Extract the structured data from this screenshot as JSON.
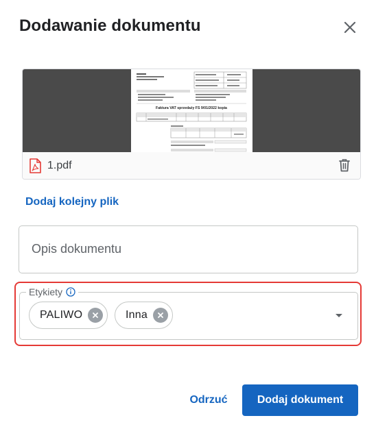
{
  "dialog": {
    "title": "Dodawanie dokumentu"
  },
  "file": {
    "name": "1.pdf",
    "icon": "pdf-file-icon",
    "preview": {
      "heading": "Faktura VAT sprzedaży FS 9/01/2022 kopia"
    }
  },
  "actions": {
    "add_file": "Dodaj kolejny plik",
    "discard": "Odrzuć",
    "submit": "Dodaj dokument"
  },
  "description": {
    "placeholder": "Opis dokumentu",
    "value": ""
  },
  "tags": {
    "label": "Etykiety",
    "items": [
      {
        "label": "PALIWO"
      },
      {
        "label": "Inna"
      }
    ]
  },
  "colors": {
    "accent": "#1565c0",
    "highlight": "#e53935",
    "pdf": "#e53935"
  }
}
